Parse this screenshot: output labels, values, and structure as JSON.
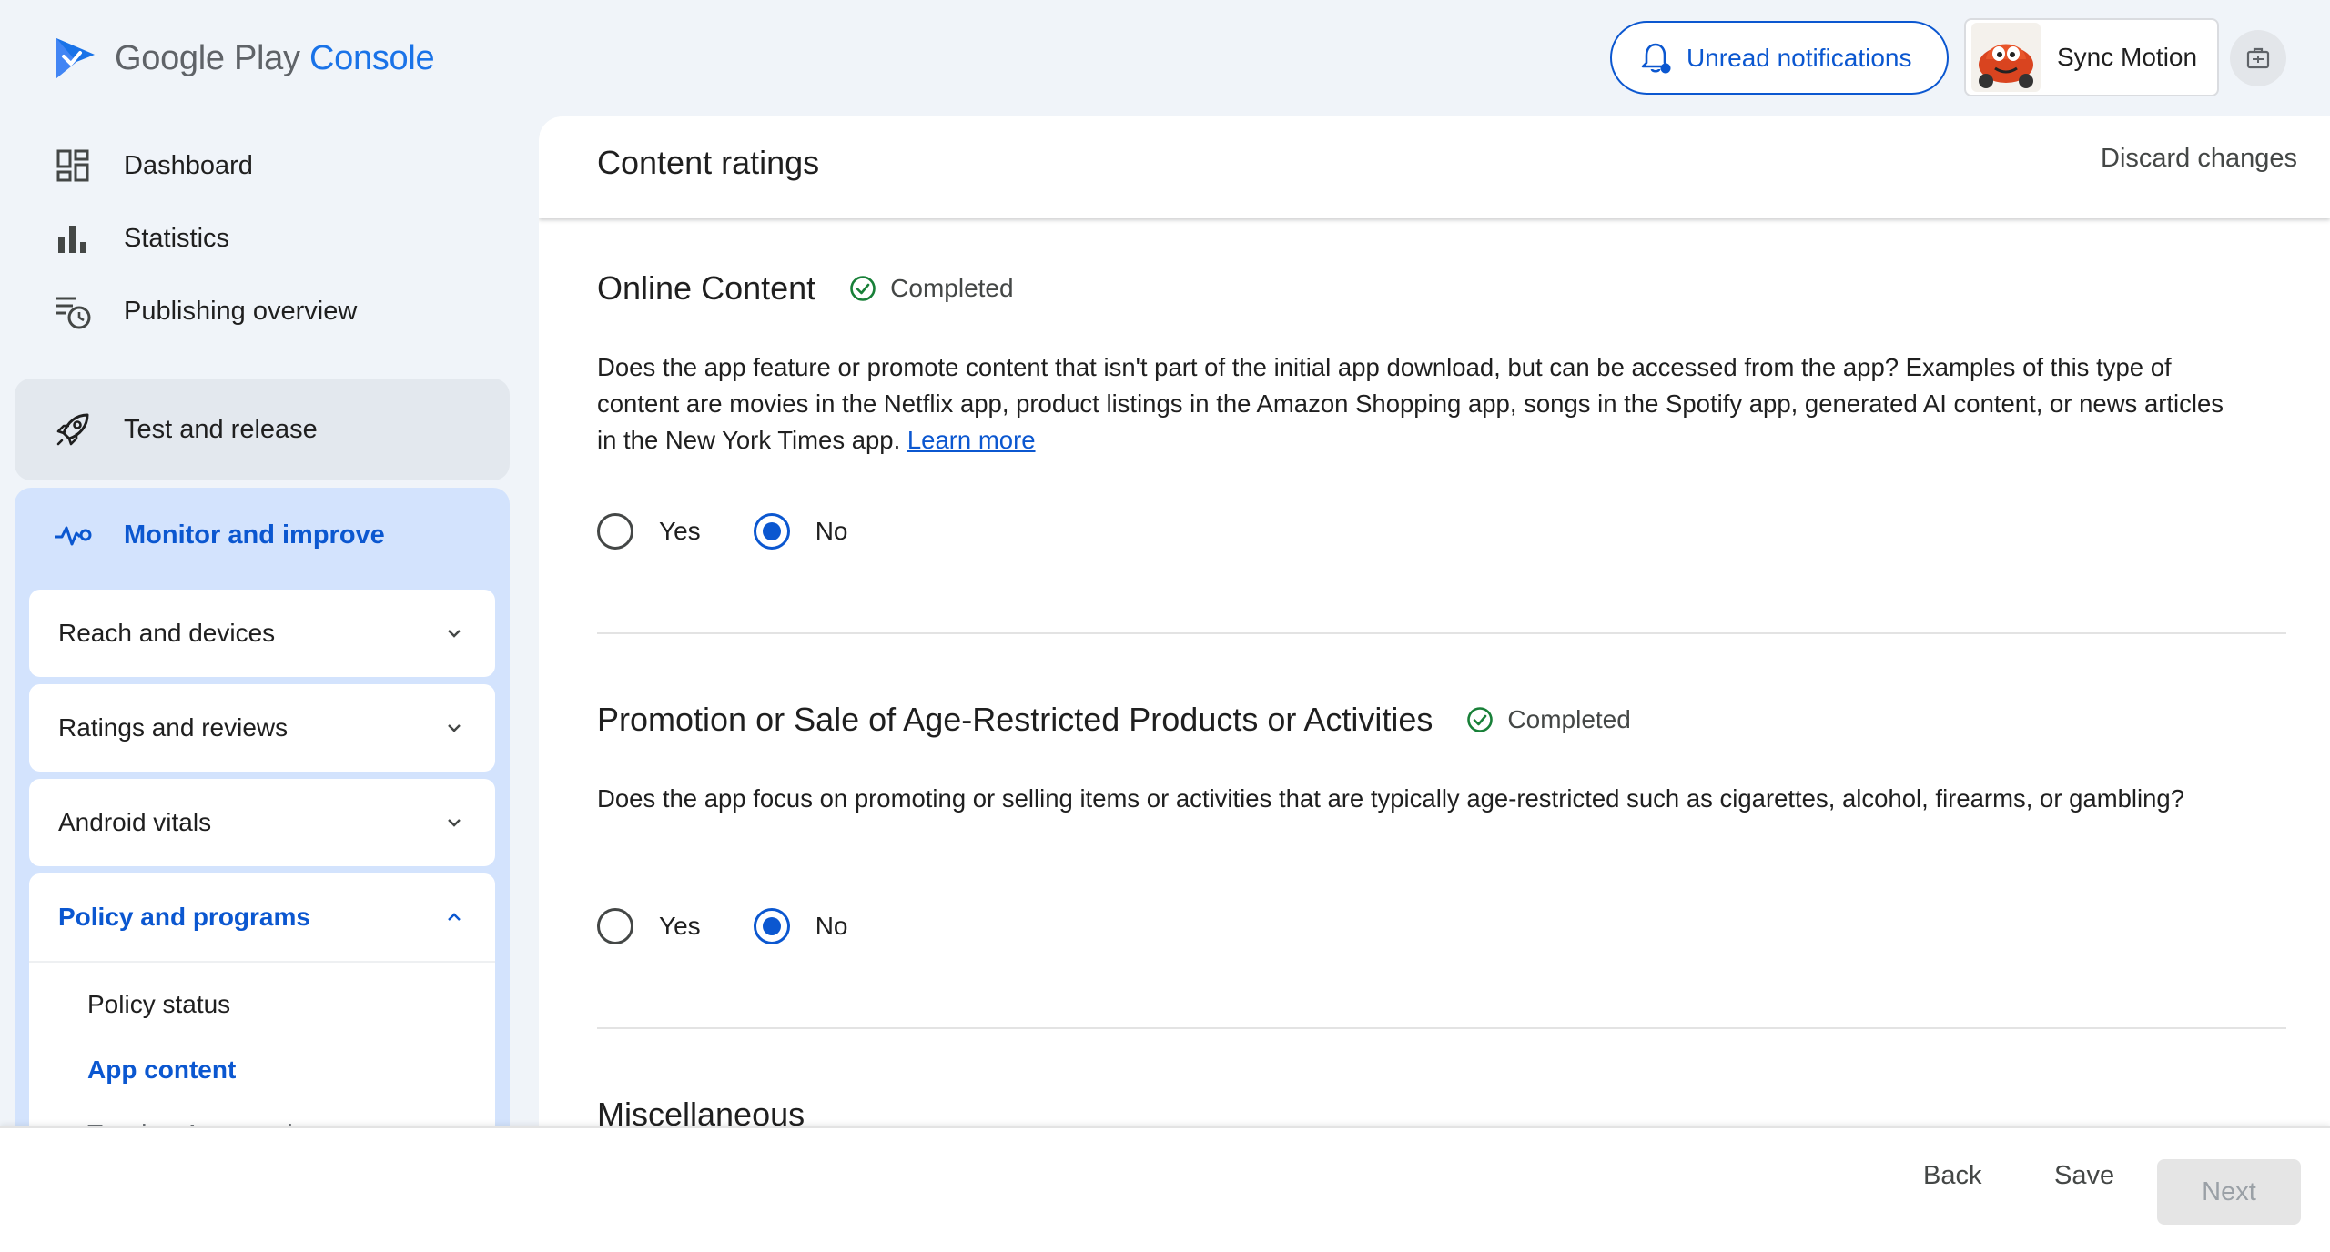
{
  "header": {
    "logo_main": "Google Play",
    "logo_sub": "Console",
    "notifications_label": "Unread notifications",
    "account_name": "Sync Motion"
  },
  "sidebar": {
    "items": [
      {
        "label": "Dashboard",
        "icon": "dashboard-icon"
      },
      {
        "label": "Statistics",
        "icon": "bar-chart-icon"
      },
      {
        "label": "Publishing overview",
        "icon": "publishing-clock-icon"
      }
    ],
    "test_release": "Test and release",
    "monitor": {
      "label": "Monitor and improve",
      "subsections": [
        {
          "label": "Reach and devices",
          "expanded": false
        },
        {
          "label": "Ratings and reviews",
          "expanded": false
        },
        {
          "label": "Android vitals",
          "expanded": false
        },
        {
          "label": "Policy and programs",
          "expanded": true
        }
      ],
      "policy_items": [
        "Policy status",
        "App content",
        "Teacher Approved"
      ]
    }
  },
  "main": {
    "title": "Content ratings",
    "discard_label": "Discard changes",
    "sections": [
      {
        "title": "Online Content",
        "status": "Completed",
        "question": "Does the app feature or promote content that isn't part of the initial app download, but can be accessed from the app? Examples of this type of content are movies in the Netflix app, product listings in the Amazon Shopping app, songs in the Spotify app, generated AI content, or news articles in the New York Times app.",
        "link": "Learn more",
        "options": [
          "Yes",
          "No"
        ],
        "selected": "No"
      },
      {
        "title": "Promotion or Sale of Age-Restricted Products or Activities",
        "status": "Completed",
        "question": "Does the app focus on promoting or selling items or activities that are typically age-restricted such as cigarettes, alcohol, firearms, or gambling?",
        "options": [
          "Yes",
          "No"
        ],
        "selected": "No"
      },
      {
        "title": "Miscellaneous"
      }
    ]
  },
  "footer": {
    "back": "Back",
    "save": "Save",
    "next": "Next"
  },
  "colors": {
    "accent": "#0b57d0",
    "success": "#188038",
    "page_bg": "#f0f4f9",
    "selected_nav_bg": "#d3e3fd"
  }
}
